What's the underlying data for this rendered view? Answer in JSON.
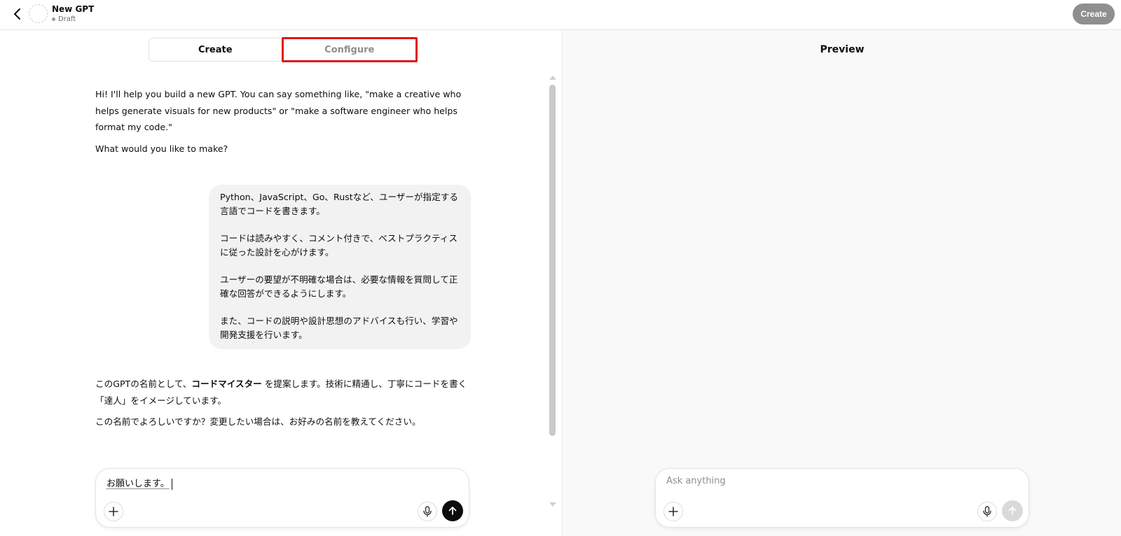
{
  "header": {
    "gpt_name": "New GPT",
    "status": "Draft",
    "create_button": "Create"
  },
  "tabs": [
    {
      "label": "Create",
      "active": true
    },
    {
      "label": "Configure",
      "active": false,
      "highlighted": true
    }
  ],
  "conversation": {
    "assistant_intro": [
      "Hi! I'll help you build a new GPT. You can say something like, \"make a creative who helps generate visuals for new products\" or \"make a software engineer who helps format my code.\"",
      "What would you like to make?"
    ],
    "user_message": [
      "Python、JavaScript、Go、Rustなど、ユーザーが指定する言語でコードを書きます。",
      "コードは読みやすく、コメント付きで、ベストプラクティスに従った設計を心がけます。",
      "ユーザーの要望が不明確な場合は、必要な情報を質問して正確な回答ができるようにします。",
      "また、コードの説明や設計思想のアドバイスも行い、学習や開発支援を行います。"
    ],
    "assistant_reply": {
      "line1_prefix": "このGPTの名前として、",
      "line1_bold": "コードマイスター",
      "line1_suffix": " を提案します。技術に精通し、丁寧にコードを書く「達人」をイメージしています。",
      "line2": "この名前でよろしいですか？変更したい場合は、お好みの名前を教えてください。"
    }
  },
  "left_composer": {
    "value": "お願いします。"
  },
  "preview": {
    "title": "Preview",
    "placeholder": "Ask anything"
  },
  "icons": {
    "back": "chevron-left-icon",
    "plus": "plus-icon",
    "mic": "microphone-icon",
    "send": "arrow-up-icon"
  },
  "colors": {
    "highlight_border": "#e3161b",
    "create_button_bg": "#8f8f8f",
    "user_bubble_bg": "#f2f2f2",
    "preview_bg": "#f9f9f9"
  }
}
